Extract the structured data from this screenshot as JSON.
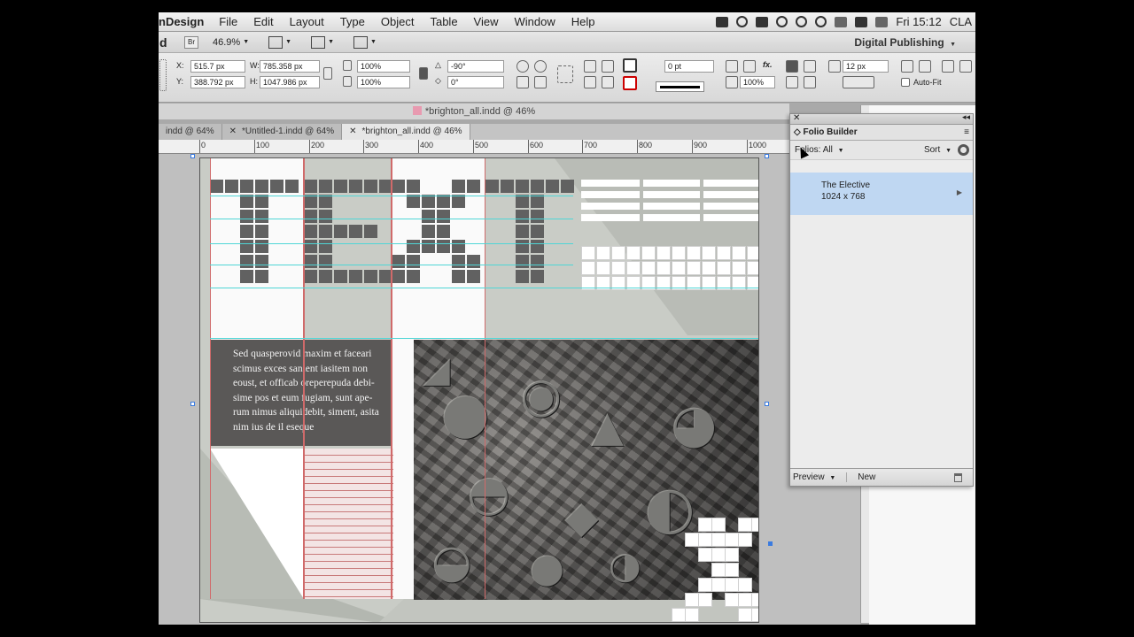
{
  "menubar": {
    "app": "nDesign",
    "items": [
      "File",
      "Edit",
      "Layout",
      "Type",
      "Object",
      "Table",
      "View",
      "Window",
      "Help"
    ],
    "clock": "Fri 15:12",
    "user": "CLA"
  },
  "appbar": {
    "logo": "d",
    "bridge": "Br",
    "zoom": "46.9%",
    "workspace": "Digital Publishing"
  },
  "control": {
    "x_label": "X:",
    "x_value": "515.7 px",
    "y_label": "Y:",
    "y_value": "388.792 px",
    "w_label": "W:",
    "w_value": "785.358 px",
    "h_label": "H:",
    "h_value": "1047.986 px",
    "scale_x": "100%",
    "scale_y": "100%",
    "rotate": "-90°",
    "shear": "0°",
    "stroke_weight": "0 pt",
    "opacity": "100%",
    "offset": "12 px",
    "autofit": "Auto-Fit"
  },
  "document": {
    "title": "*brighton_all.indd @ 46%",
    "tabs": [
      {
        "label": "indd @ 64%",
        "active": false
      },
      {
        "label": "*Untitled-1.indd @ 64%",
        "active": false
      },
      {
        "label": "*brighton_all.indd @ 46%",
        "active": true
      }
    ]
  },
  "ruler": {
    "labels": [
      "0",
      "100",
      "200",
      "300",
      "400",
      "500",
      "600",
      "700",
      "800",
      "900",
      "1000"
    ]
  },
  "page": {
    "body_text": "Sed quasperovid maxim et faceari scimus exces sanient iasitem non eoust, et officab oreperepuda debi-sime pos et eum fugiam, sunt ape-rum nimus aliquidebit, siment, asita nim ius de il eseque"
  },
  "panel": {
    "title": "Folio Builder",
    "filter_label": "Folios:",
    "filter_value": "All",
    "sort_label": "Sort",
    "folio_name": "The Elective",
    "folio_size": "1024 x 768",
    "preview_label": "Preview",
    "new_label": "New"
  },
  "colors": {
    "page_bg": "#c9ccc6",
    "pixel_dark": "#616161",
    "guide": "#4fd6d6",
    "column_guide": "#d06a6a",
    "folio_selected": "#bfd7f2"
  }
}
